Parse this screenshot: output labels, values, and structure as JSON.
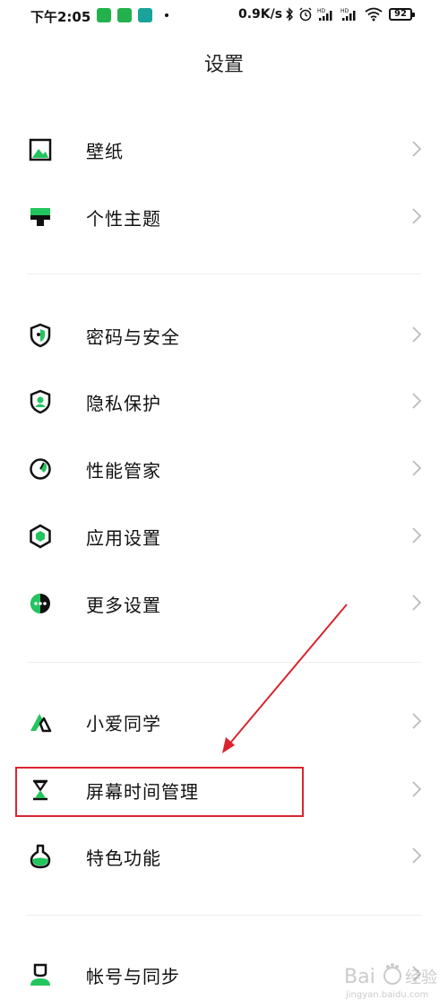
{
  "status_bar": {
    "time": "下午2:05",
    "network_speed": "0.9K/s",
    "battery": "92"
  },
  "title": "设置",
  "items": [
    {
      "label": "壁纸",
      "icon": "wallpaper-icon"
    },
    {
      "label": "个性主题",
      "icon": "theme-icon"
    },
    {
      "label": "密码与安全",
      "icon": "shield-lock-icon"
    },
    {
      "label": "隐私保护",
      "icon": "privacy-shield-icon"
    },
    {
      "label": "性能管家",
      "icon": "performance-gauge-icon"
    },
    {
      "label": "应用设置",
      "icon": "hexagon-icon"
    },
    {
      "label": "更多设置",
      "icon": "more-dots-icon"
    },
    {
      "label": "小爱同学",
      "icon": "xiaoai-icon"
    },
    {
      "label": "屏幕时间管理",
      "icon": "hourglass-icon"
    },
    {
      "label": "特色功能",
      "icon": "flask-icon"
    },
    {
      "label": "帐号与同步",
      "icon": "account-icon"
    }
  ],
  "colors": {
    "accent": "#22c55e",
    "icon_dark": "#111111",
    "annotation": "#d9252e"
  }
}
